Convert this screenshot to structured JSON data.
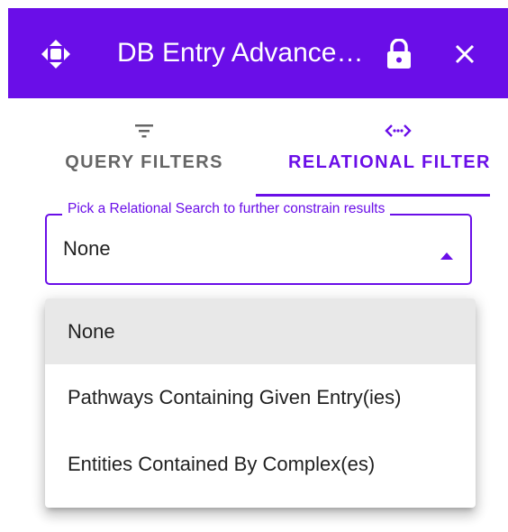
{
  "colors": {
    "accent": "#6a0ee8",
    "selected_bg": "#e8e8e8",
    "inactive_tab": "#666666"
  },
  "header": {
    "title": "DB Entry Advance…",
    "move_icon": "move-arrows-icon",
    "lock_icon": "lock-icon",
    "close_icon": "close-icon"
  },
  "tabs": [
    {
      "label": "QUERY FILTERS",
      "icon": "filter-list-icon",
      "active": false
    },
    {
      "label": "RELATIONAL FILTER",
      "icon": "code-brackets-icon",
      "active": true
    }
  ],
  "relational_select": {
    "legend": "Pick a Relational Search to further constrain results",
    "value": "None",
    "arrow_icon": "arrow-up-icon"
  },
  "menu": {
    "options": [
      {
        "label": "None",
        "selected": true
      },
      {
        "label": "Pathways Containing Given Entry(ies)",
        "selected": false
      },
      {
        "label": "Entities Contained By Complex(es)",
        "selected": false
      }
    ]
  }
}
